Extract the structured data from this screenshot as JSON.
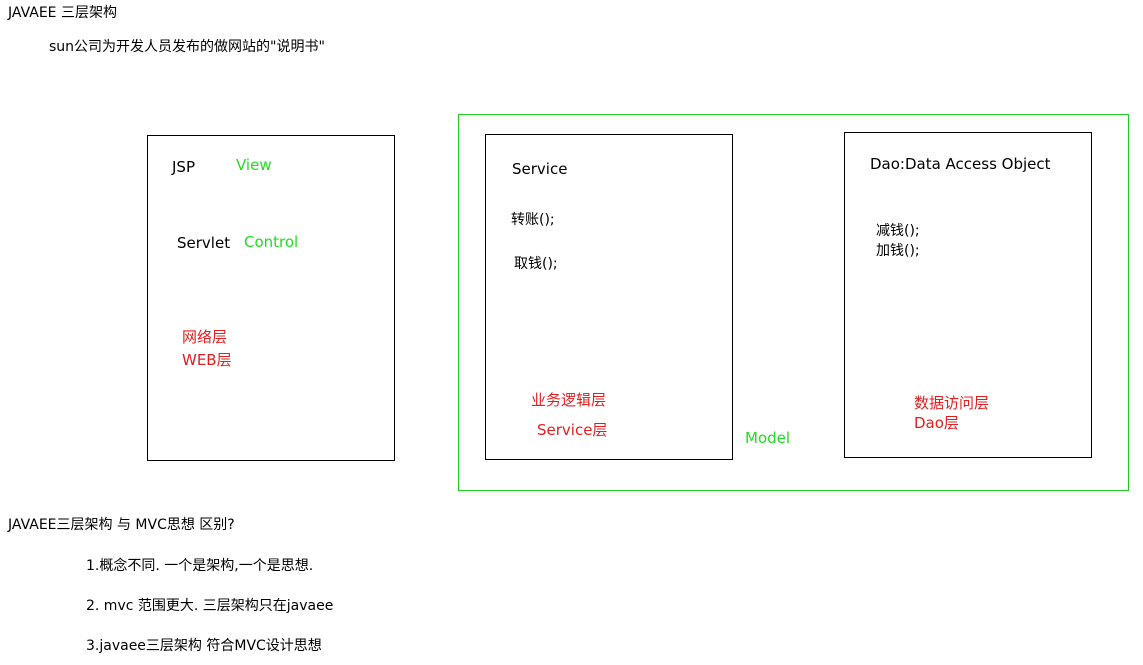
{
  "header": {
    "title": "JAVAEE 三层架构",
    "subtitle": "sun公司为开发人员发布的做网站的\"说明书\""
  },
  "web_layer": {
    "jsp": "JSP",
    "view": "View",
    "servlet": "Servlet",
    "control": "Control",
    "label_line1": "网络层",
    "label_line2": "WEB层"
  },
  "service_layer": {
    "title": "Service",
    "method1": "转账();",
    "method2": "取钱();",
    "label_line1": "业务逻辑层",
    "label_line2": "Service层"
  },
  "model": {
    "label": "Model"
  },
  "dao_layer": {
    "title": "Dao:Data Access Object",
    "method1": "减钱();",
    "method2": "加钱();",
    "label_line1": "数据访问层",
    "label_line2": "Dao层"
  },
  "comparison": {
    "question": "JAVAEE三层架构 与 MVC思想  区别?",
    "points": [
      "1.概念不同. 一个是架构,一个是思想.",
      "2. mvc 范围更大. 三层架构只在javaee",
      "3.javaee三层架构 符合MVC设计思想"
    ]
  },
  "colors": {
    "green": "#22dd22",
    "red": "#e02020",
    "model_border": "#22cc22"
  }
}
